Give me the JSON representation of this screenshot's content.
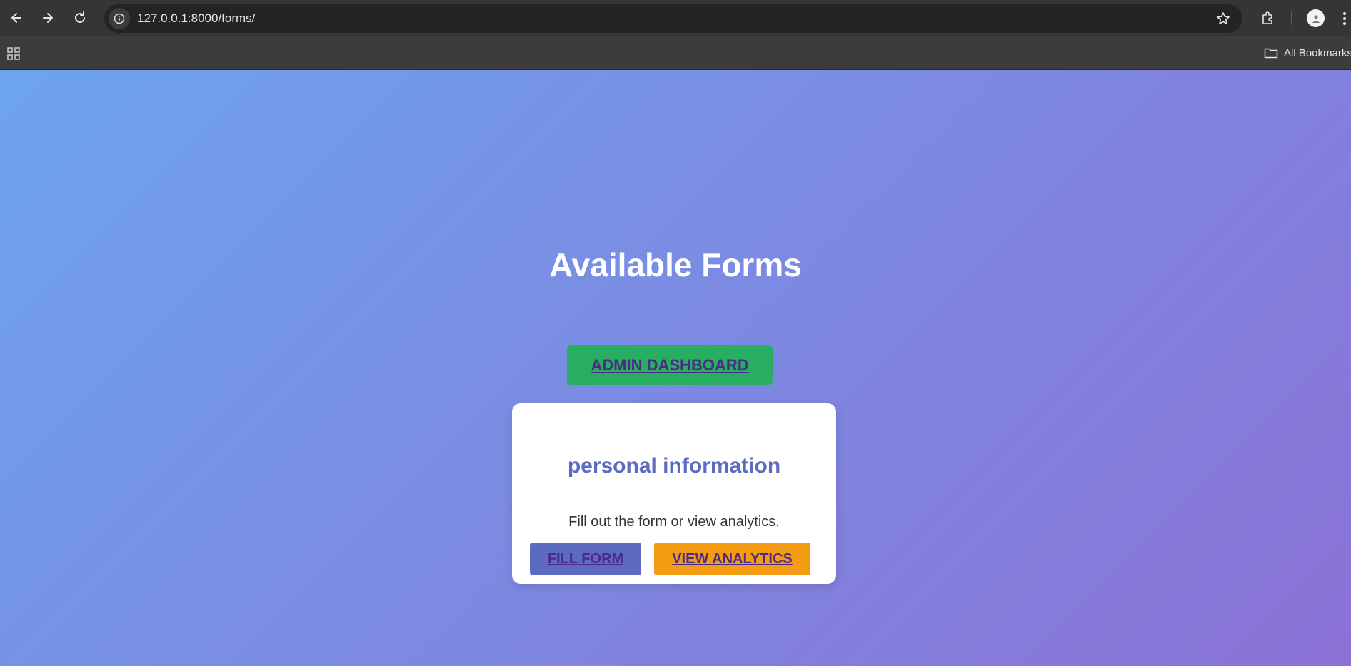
{
  "browser": {
    "url": "127.0.0.1:8000/forms/",
    "bookmarks_label": "All Bookmarks"
  },
  "page": {
    "title": "Available Forms",
    "admin_button": "ADMIN DASHBOARD",
    "forms": [
      {
        "title": "personal information",
        "description": "Fill out the form or view analytics.",
        "fill_label": "FILL FORM",
        "analytics_label": "VIEW ANALYTICS"
      }
    ]
  },
  "colors": {
    "gradient_start": "#6da4ee",
    "gradient_end": "#8b71d5",
    "admin_button": "#27ae60",
    "fill_button": "#5c6bc0",
    "analytics_button": "#f39c12",
    "card_title": "#5b6bc0",
    "link_text": "#4b2a8a"
  }
}
